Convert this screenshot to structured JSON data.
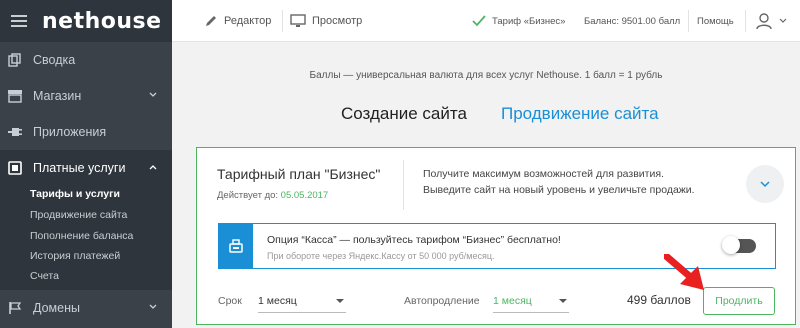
{
  "logo": "nethouse",
  "sidebar": {
    "items": [
      {
        "label": "Сводка",
        "icon": "copy-icon"
      },
      {
        "label": "Магазин",
        "icon": "shop-icon"
      },
      {
        "label": "Приложения",
        "icon": "plug-icon"
      },
      {
        "label": "Платные услуги",
        "icon": "card-icon"
      },
      {
        "label": "Домены",
        "icon": "flag-icon"
      }
    ],
    "sub_items": [
      "Тарифы и услуги",
      "Продвижение сайта",
      "Пополнение баланса",
      "История платежей",
      "Счета"
    ]
  },
  "topbar": {
    "editor": "Редактор",
    "preview": "Просмотр",
    "tariff": "Тариф «Бизнес»",
    "balance": "Баланс: 9501.00 балл",
    "help": "Помощь"
  },
  "main": {
    "info": "Баллы — универсальная валюта для всех услуг Nethouse. 1 балл = 1 рубль",
    "tabs": [
      "Создание сайта",
      "Продвижение сайта"
    ]
  },
  "plan": {
    "title": "Тарифный план \"Бизнес\"",
    "valid_label": "Действует до:",
    "valid_date": "05.05.2017",
    "desc_line1": "Получите максимум возможностей для развития.",
    "desc_line2": "Выведите сайт на новый уровень и увеличьте продажи."
  },
  "kassa": {
    "title": "Опция “Касса” — пользуйтесь тарифом “Бизнес” бесплатно!",
    "subtitle": "При обороте через Яндекс.Кассу от 50 000 руб/месяц."
  },
  "controls": {
    "term_label": "Срок",
    "term_value": "1 месяц",
    "auto_label": "Автопродление",
    "auto_value": "1 месяц",
    "price": "499 баллов",
    "extend": "Продлить"
  },
  "colors": {
    "green": "#4cb562",
    "blue": "#1a8fd6",
    "sidebar": "#3a4149"
  }
}
